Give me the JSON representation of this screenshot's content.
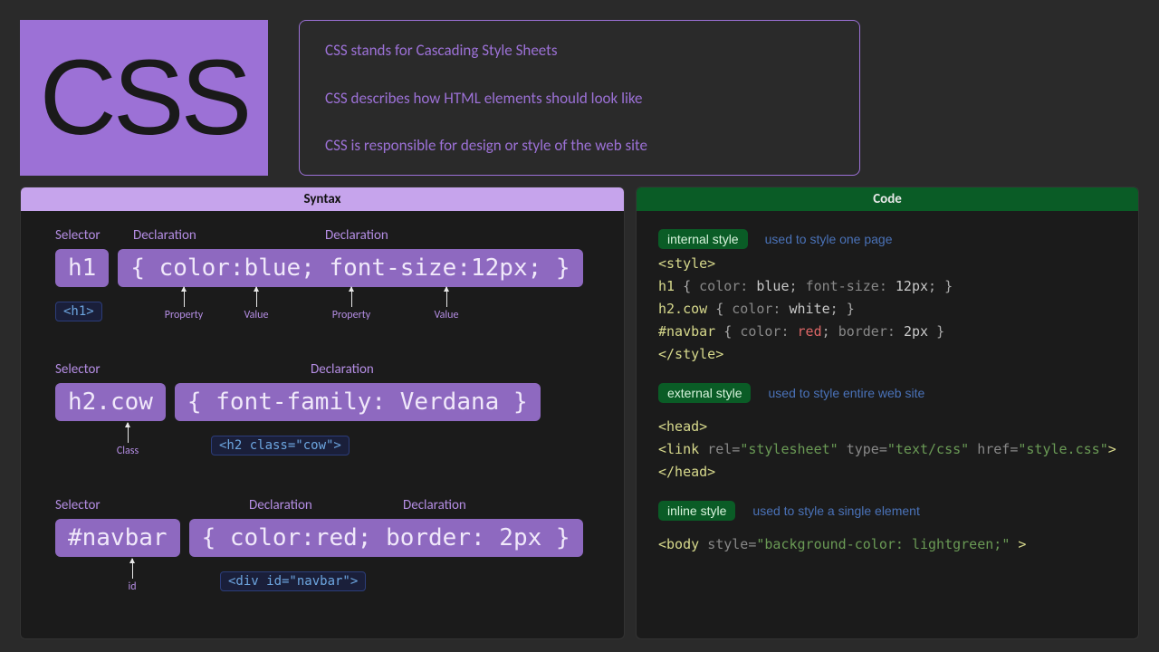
{
  "header": {
    "logo_text": "CSS",
    "intro": [
      "CSS stands for Cascading Style Sheets",
      "CSS describes how HTML elements should look like",
      "CSS is responsible for design or style of the web site"
    ]
  },
  "syntax": {
    "title": "Syntax",
    "labels": {
      "selector": "Selector",
      "declaration": "Declaration",
      "property": "Property",
      "value": "Value",
      "class": "Class",
      "id": "id"
    },
    "rows": [
      {
        "selector_chip": "h1",
        "declaration_chip": "{ color:blue; font-size:12px; }",
        "declaration_count": 2,
        "html_tag": "<h1>",
        "sublabels": [
          "Property",
          "Value",
          "Property",
          "Value"
        ],
        "selector_note": null
      },
      {
        "selector_chip": "h2.cow",
        "declaration_chip": "{ font-family: Verdana }",
        "declaration_count": 1,
        "html_tag": "<h2 class=\"cow\">",
        "sublabels": [],
        "selector_note": "Class"
      },
      {
        "selector_chip": "#navbar",
        "declaration_chip": "{ color:red; border: 2px }",
        "declaration_count": 2,
        "html_tag": "<div id=\"navbar\">",
        "sublabels": [],
        "selector_note": "id"
      }
    ]
  },
  "code": {
    "title": "Code",
    "internal": {
      "badge": "internal style",
      "desc": "used to style one page",
      "open_tag": "<style>",
      "lines": [
        {
          "sel": "h1",
          "body": "color: blue; font-size: 12px;"
        },
        {
          "sel": "h2.cow",
          "body": "color: white;"
        },
        {
          "sel": "#navbar",
          "body": "color: red; border: 2px"
        }
      ],
      "close_tag": "</style>"
    },
    "external": {
      "badge": "external style",
      "desc": "used to style entire web site",
      "head_open": "<head>",
      "link_tag": "link",
      "link_rel": "stylesheet",
      "link_type": "text/css",
      "link_href": "style.css",
      "head_close": "</head>"
    },
    "inline": {
      "badge": "inline style",
      "desc": "used to style a single element",
      "body_tag": "body",
      "style_value": "background-color: lightgreen;"
    }
  }
}
